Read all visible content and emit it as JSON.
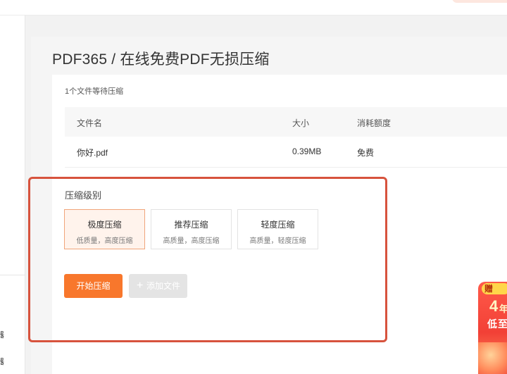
{
  "sidebar": {
    "items": [
      {
        "label": "器"
      },
      {
        "label": "器"
      }
    ]
  },
  "page": {
    "title": "PDF365 / 在线免费PDF无损压缩"
  },
  "files": {
    "status": "1个文件等待压缩",
    "columns": [
      "文件名",
      "大小",
      "消耗额度"
    ],
    "rows": [
      {
        "name": "你好.pdf",
        "size": "0.39MB",
        "quota": "免费"
      }
    ]
  },
  "compress": {
    "section_label": "压缩级别",
    "levels": [
      {
        "name": "极度压缩",
        "desc": "低质量，高度压缩",
        "selected": true
      },
      {
        "name": "推荐压缩",
        "desc": "高质量，高度压缩",
        "selected": false
      },
      {
        "name": "轻度压缩",
        "desc": "高质量，轻度压缩",
        "selected": false
      }
    ],
    "start_label": "开始压缩",
    "add_label": "添加文件"
  },
  "promo": {
    "tag": "赠",
    "big": "4",
    "small": "年",
    "low": "低至"
  },
  "colors": {
    "accent": "#f8772c",
    "highlight_border": "#d7533d",
    "selected_bg": "#fff3ec"
  }
}
